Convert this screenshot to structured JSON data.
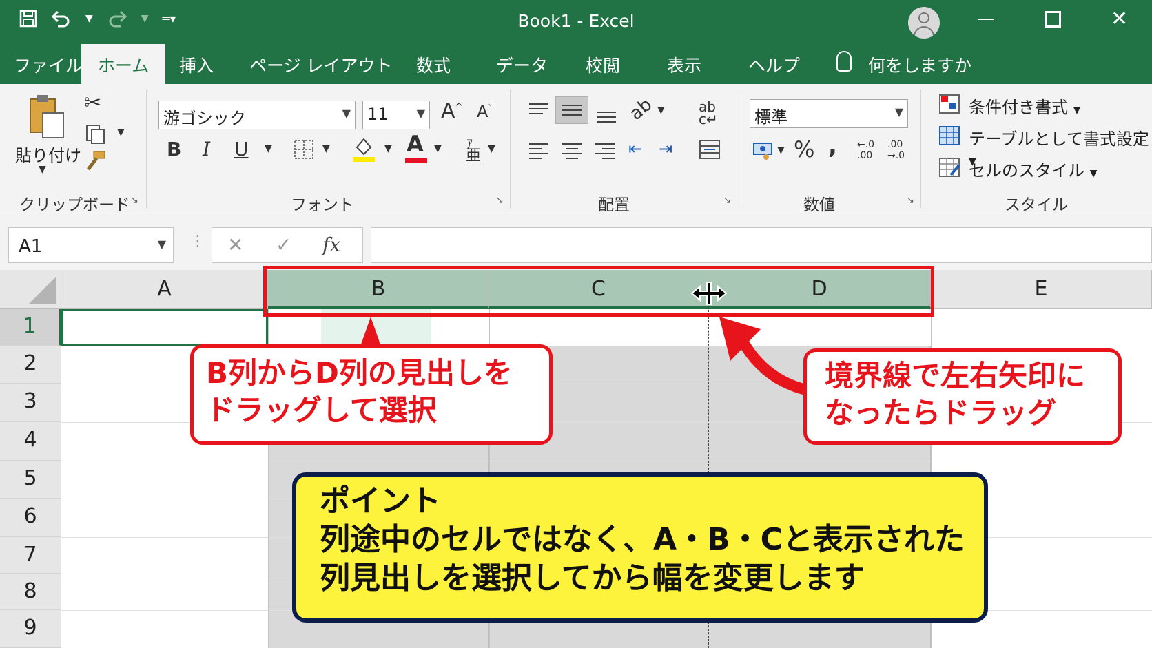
{
  "window": {
    "title": "Book1  -  Excel"
  },
  "quick_access": {
    "save_icon": "save-icon",
    "undo_icon": "undo-icon",
    "redo_icon": "redo-icon",
    "customize_icon": "customize-icon"
  },
  "tabs": [
    {
      "label": "ファイル"
    },
    {
      "label": "ホーム"
    },
    {
      "label": "挿入"
    },
    {
      "label": "ページ レイアウト"
    },
    {
      "label": "数式"
    },
    {
      "label": "データ"
    },
    {
      "label": "校閲"
    },
    {
      "label": "表示"
    },
    {
      "label": "ヘルプ"
    },
    {
      "label": "何をしますか"
    }
  ],
  "ribbon": {
    "clipboard": {
      "paste_label": "貼り付け",
      "group_label": "クリップボード"
    },
    "font": {
      "font_name": "游ゴシック",
      "font_size": "11",
      "grow_label": "A",
      "shrink_label": "A",
      "bold": "B",
      "italic": "I",
      "underline": "U",
      "font_color_label": "A",
      "group_label": "フォント"
    },
    "alignment": {
      "group_label": "配置"
    },
    "number": {
      "format": "標準",
      "percent": "%",
      "comma": ",",
      "inc_decimal": "←.0 .00",
      "dec_decimal": ".00 →.0",
      "group_label": "数値"
    },
    "styles": {
      "conditional": "条件付き書式",
      "table": "テーブルとして書式設定",
      "cell_styles": "セルのスタイル",
      "group_label": "スタイル"
    }
  },
  "formula_bar": {
    "name_box": "A1",
    "cancel": "✕",
    "enter": "✓",
    "fx": "fx",
    "value": ""
  },
  "columns": [
    "A",
    "B",
    "C",
    "D",
    "E"
  ],
  "rows": [
    "1",
    "2",
    "3",
    "4",
    "5",
    "6",
    "7",
    "8",
    "9"
  ],
  "selected_columns": [
    "B",
    "C",
    "D"
  ],
  "active_cell": "A1",
  "annotations": {
    "left_callout": [
      "B列からD列の見出しを",
      "ドラッグして選択"
    ],
    "right_callout": [
      "境界線で左右矢印に",
      "なったらドラッグ"
    ],
    "point": {
      "title": "ポイント",
      "lines": [
        "列途中のセルではなく、A・B・Cと表示された",
        "列見出しを選択してから幅を変更します"
      ]
    }
  },
  "colors": {
    "excel_green": "#217346",
    "callout_red": "#e8141c",
    "point_yellow": "#fdf23c",
    "point_border": "#0c1d4a"
  }
}
